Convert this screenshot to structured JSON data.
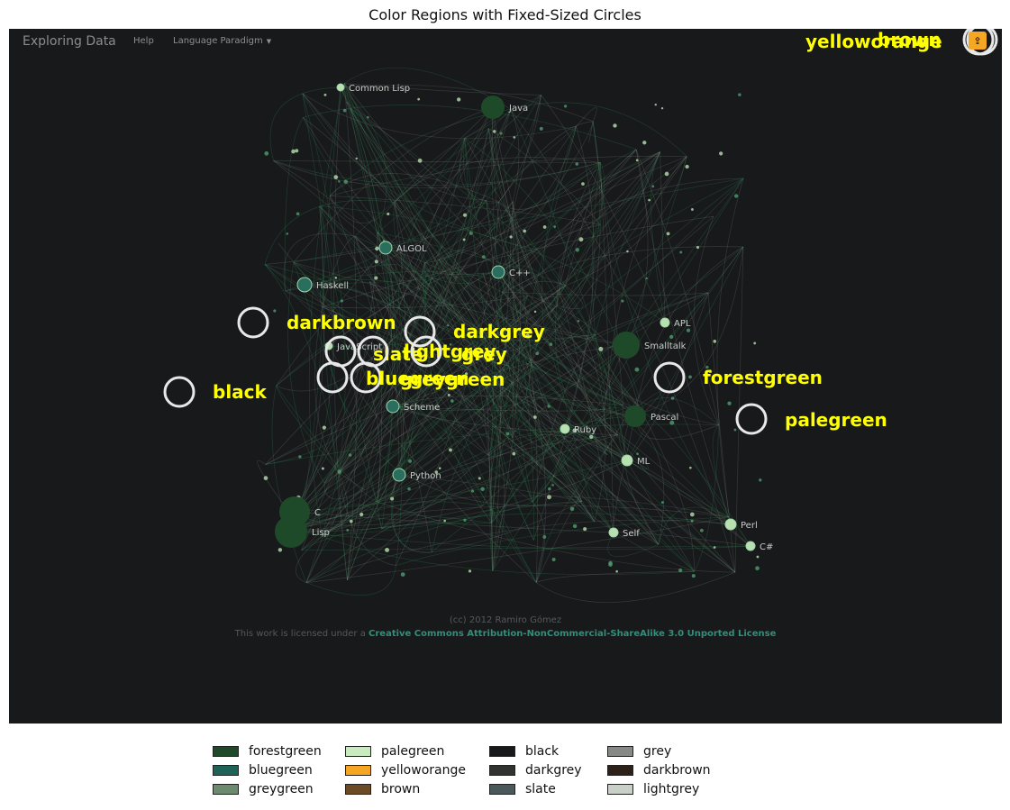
{
  "figure_title": "Color Regions with Fixed-Sized Circles",
  "app": {
    "brand": "Exploring Data",
    "nav": {
      "help": "Help",
      "paradigm": "Language Paradigm"
    },
    "share_icon": "share-icon",
    "share_color": "#f5a623"
  },
  "footer": {
    "copyright": "(cc) 2012 Ramiro Gómez",
    "license_prefix": "This work is licensed under a",
    "license_link": "Creative Commons Attribution-NonCommercial-ShareAlike 3.0 Unported License"
  },
  "graph_nodes": [
    {
      "label": "Common Lisp",
      "color": "#b8e0b0"
    },
    {
      "label": "Java",
      "color": "#1f4a2a"
    },
    {
      "label": "ALGOL",
      "color": "#2a6e5f"
    },
    {
      "label": "C++",
      "color": "#2a6e5f"
    },
    {
      "label": "Haskell",
      "color": "#2a6e5f"
    },
    {
      "label": "APL",
      "color": "#b8e0b0"
    },
    {
      "label": "Smalltalk",
      "color": "#1f4a2a"
    },
    {
      "label": "JavaScript",
      "color": "#b8e0b0"
    },
    {
      "label": "Scheme",
      "color": "#2a6e5f"
    },
    {
      "label": "Pascal",
      "color": "#1f4a2a"
    },
    {
      "label": "Ruby",
      "color": "#b8e0b0"
    },
    {
      "label": "ML",
      "color": "#b8e0b0"
    },
    {
      "label": "Python",
      "color": "#2a6e5f"
    },
    {
      "label": "C",
      "color": "#1f4a2a"
    },
    {
      "label": "Lisp",
      "color": "#1f4a2a"
    },
    {
      "label": "Self",
      "color": "#b8e0b0"
    },
    {
      "label": "Perl",
      "color": "#b8e0b0"
    },
    {
      "label": "C#",
      "color": "#b8e0b0"
    }
  ],
  "regions": [
    {
      "label": "yelloworange"
    },
    {
      "label": "brown"
    },
    {
      "label": "darkbrown"
    },
    {
      "label": "darkgrey"
    },
    {
      "label": "slate"
    },
    {
      "label": "lightgrey"
    },
    {
      "label": "grey"
    },
    {
      "label": "bluegreen"
    },
    {
      "label": "greygreen"
    },
    {
      "label": "black"
    },
    {
      "label": "forestgreen"
    },
    {
      "label": "palegreen"
    }
  ],
  "legend": [
    {
      "label": "forestgreen",
      "color": "#1f4a2a"
    },
    {
      "label": "bluegreen",
      "color": "#1f6258"
    },
    {
      "label": "greygreen",
      "color": "#6c8a6e"
    },
    {
      "label": "palegreen",
      "color": "#c8ecc0"
    },
    {
      "label": "yelloworange",
      "color": "#f5a623"
    },
    {
      "label": "brown",
      "color": "#6b4a25"
    },
    {
      "label": "black",
      "color": "#18191b"
    },
    {
      "label": "darkgrey",
      "color": "#303230"
    },
    {
      "label": "slate",
      "color": "#4a585c"
    },
    {
      "label": "grey",
      "color": "#858a84"
    },
    {
      "label": "darkbrown",
      "color": "#2e2218"
    },
    {
      "label": "lightgrey",
      "color": "#c8d0c8"
    }
  ]
}
